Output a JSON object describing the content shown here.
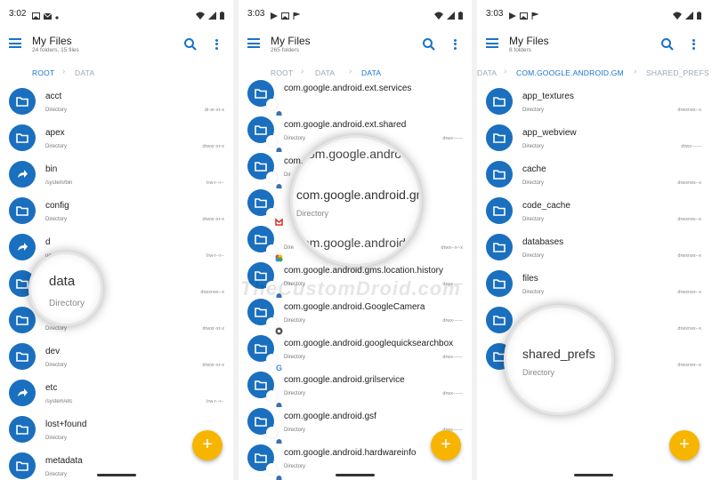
{
  "colors": {
    "accent": "#1a73c9",
    "folder": "#1a6fbf",
    "fab": "#f7b500"
  },
  "phones": [
    {
      "time": "3:02",
      "title": "My Files",
      "subtitle": "24 folders, 15 files",
      "breadcrumb": [
        "ROOT",
        "DATA"
      ],
      "rows": [
        {
          "name": "acct",
          "sub": "Directory",
          "perm": "dr-xr-xr-x",
          "icon": "folder-icon"
        },
        {
          "name": "apex",
          "sub": "Directory",
          "perm": "drwxr-xr-x",
          "icon": "folder-icon"
        },
        {
          "name": "bin",
          "sub": "/system/bin",
          "perm": "lrw-r--r--",
          "icon": "symlink-icon"
        },
        {
          "name": "config",
          "sub": "Directory",
          "perm": "drwxr-xr-x",
          "icon": "folder-icon"
        },
        {
          "name": "d",
          "sub": "ug",
          "perm": "lrw-r--r--",
          "icon": "symlink-icon"
        },
        {
          "name": "",
          "sub": "",
          "perm": "drwxrwx--x",
          "icon": "folder-icon"
        },
        {
          "name": "ndisk",
          "sub": "Directory",
          "perm": "drwxr-xr-x",
          "icon": "folder-icon"
        },
        {
          "name": "dev",
          "sub": "Directory",
          "perm": "drwxr-xr-x",
          "icon": "folder-icon"
        },
        {
          "name": "etc",
          "sub": "/system/etc",
          "perm": "lrw-r--r--",
          "icon": "symlink-icon"
        },
        {
          "name": "lost+found",
          "sub": "Directory",
          "perm": "",
          "icon": "folder-icon"
        },
        {
          "name": "metadata",
          "sub": "Directory",
          "perm": "",
          "icon": "folder-icon"
        }
      ],
      "magnifier": {
        "name": "data",
        "sub": "Directory"
      }
    },
    {
      "time": "3:03",
      "title": "My Files",
      "subtitle": "265 folders",
      "breadcrumb": [
        "ROOT",
        "DATA",
        "DATA"
      ],
      "rows": [
        {
          "name": "com.google.android.ext.services",
          "sub": "",
          "perm": "",
          "icon": "android-badge-icon"
        },
        {
          "name": "com.google.android.ext.shared",
          "sub": "Directory",
          "perm": "drwx------",
          "icon": "android-badge-icon"
        },
        {
          "name": "com.",
          "sub": "Dir",
          "perm": "",
          "icon": "android-badge-icon"
        },
        {
          "name": "",
          "sub": "",
          "perm": "",
          "icon": "gmail-badge-icon"
        },
        {
          "name": "",
          "sub": "Dire",
          "perm": "drwx--x--x",
          "icon": "photos-badge-icon"
        },
        {
          "name": "com.google.android.gms.location.history",
          "sub": "Directory",
          "perm": "drwx------",
          "icon": "android-badge-icon"
        },
        {
          "name": "com.google.android.GoogleCamera",
          "sub": "Directory",
          "perm": "drwx------",
          "icon": "camera-badge-icon"
        },
        {
          "name": "com.google.android.googlequicksearchbox",
          "sub": "Directory",
          "perm": "drwx------",
          "icon": "google-badge-icon"
        },
        {
          "name": "com.google.android.grilservice",
          "sub": "Directory",
          "perm": "drwx------",
          "icon": "android-badge-icon"
        },
        {
          "name": "com.google.android.gsf",
          "sub": "Directory",
          "perm": "drwx------",
          "icon": "android-badge-icon"
        },
        {
          "name": "com.google.android.hardwareinfo",
          "sub": "Directory",
          "perm": "",
          "icon": "android-badge-icon"
        }
      ],
      "magnifier": {
        "top": "com.google.android",
        "name": "com.google.android.gm",
        "sub": "Directory",
        "bottom": "com.google.android.c"
      }
    },
    {
      "time": "3:03",
      "title": "My Files",
      "subtitle": "8 folders",
      "breadcrumb": [
        "DATA",
        "COM.GOOGLE.ANDROID.GM",
        "SHARED_PREFS"
      ],
      "rows": [
        {
          "name": "app_textures",
          "sub": "Directory",
          "perm": "drwxrwx--x",
          "icon": "folder-icon"
        },
        {
          "name": "app_webview",
          "sub": "Directory",
          "perm": "drwx------",
          "icon": "folder-icon"
        },
        {
          "name": "cache",
          "sub": "Directory",
          "perm": "drwxrws--x",
          "icon": "folder-icon"
        },
        {
          "name": "code_cache",
          "sub": "Directory",
          "perm": "drwxrws--x",
          "icon": "folder-icon"
        },
        {
          "name": "databases",
          "sub": "Directory",
          "perm": "drwxrwx--x",
          "icon": "folder-icon"
        },
        {
          "name": "files",
          "sub": "Directory",
          "perm": "drwxrwx--x",
          "icon": "folder-icon"
        },
        {
          "name": "",
          "sub": "Directory",
          "perm": "drwxrwx--x",
          "icon": "folder-icon"
        },
        {
          "name": "",
          "sub": "",
          "perm": "drwxrwx--x",
          "icon": "folder-icon"
        }
      ],
      "magnifier": {
        "name": "shared_prefs",
        "sub": "Directory"
      }
    }
  ],
  "watermark": "TheCustomDroid.com",
  "fab_label": "+"
}
